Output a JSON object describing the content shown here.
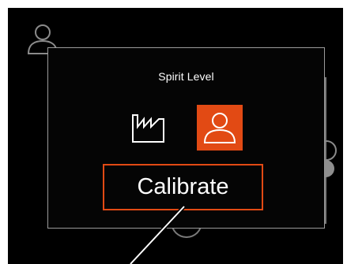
{
  "dialog": {
    "title": "Spirit Level",
    "modes": [
      {
        "icon": "factory-icon",
        "selected": false
      },
      {
        "icon": "user-icon",
        "selected": true
      }
    ],
    "calibrate_label": "Calibrate"
  },
  "colors": {
    "accent": "#e24a14",
    "background": "#000000",
    "border": "#9a9a9a"
  }
}
